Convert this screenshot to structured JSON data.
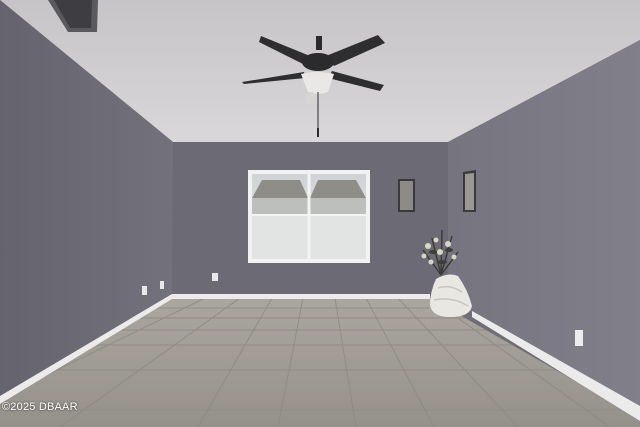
{
  "photo": {
    "watermark": "©2025 DBAAR"
  },
  "colors": {
    "ceiling": "#cfcdd0",
    "left_wall": "#6f6d78",
    "back_wall": "#6c6a74",
    "right_wall": "#7a7883",
    "floor": "#a29f97",
    "baseboard": "#ecebec",
    "fan": "#2b2b2e"
  }
}
